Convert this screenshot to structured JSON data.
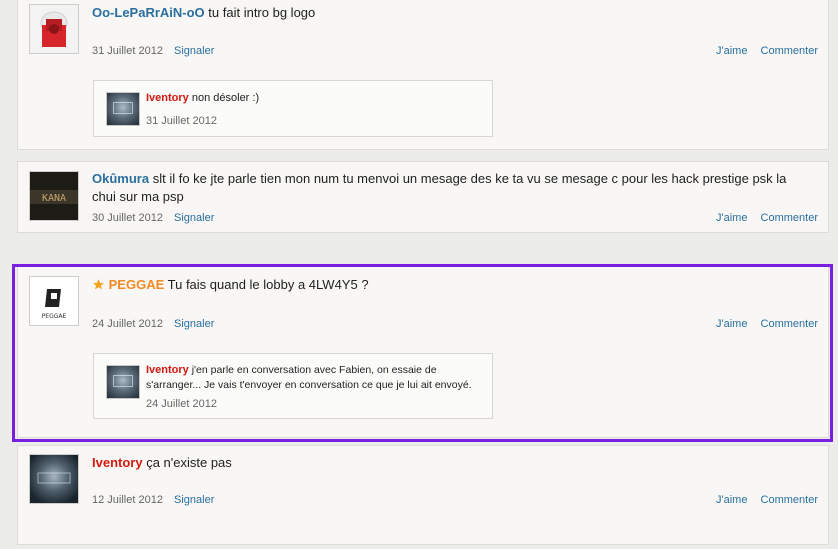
{
  "actions": {
    "like": "J'aime",
    "comment": "Commenter",
    "report": "Signaler"
  },
  "comments": [
    {
      "author": "Oo-LePaRrAiN-oO",
      "text": "tu fait intro bg logo",
      "date": "31 Juillet 2012",
      "reply": {
        "author": "Iventory",
        "text": "non désoler :)",
        "date": "31 Juillet 2012"
      }
    },
    {
      "author": "Okûmura",
      "text": "slt il fo ke jte parle tien mon num tu menvoi un mesage des ke ta vu se mesage c pour les hack prestige psk la chui sur ma psp",
      "date": "30 Juillet 2012",
      "avatar_text": "KANA"
    },
    {
      "author": "PEGGAE",
      "text": "Tu fais quand le lobby a 4LW4Y5 ?",
      "date": "24 Juillet 2012",
      "avatar_text": "PEGGAE",
      "reply": {
        "author": "Iventory",
        "text": "j'en parle en conversation avec Fabien, on essaie de s'arranger... Je vais t'envoyer en conversation ce que je lui ait envoyé.",
        "date": "24 Juillet 2012"
      }
    },
    {
      "author": "Iventory",
      "text": "ça n'existe pas",
      "date": "12 Juillet 2012"
    }
  ],
  "colors": {
    "highlight": "#7a1fe0",
    "link": "#2a6f9e",
    "author_red": "#d3190f",
    "author_orange": "#f08a24"
  }
}
